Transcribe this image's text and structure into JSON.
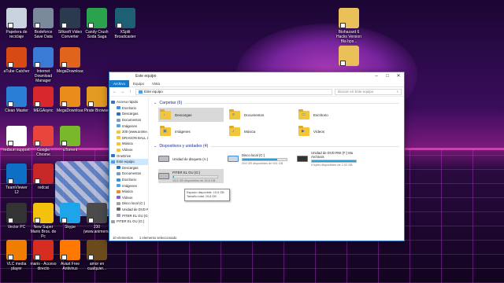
{
  "desktop": {
    "icons": [
      {
        "label": "Papelera de reciclaje",
        "icon": "recycle-bin-icon",
        "color": "#c9d3de"
      },
      {
        "label": "Bodeforce Save Data",
        "icon": "folder-icon",
        "color": "#7a8a9c"
      },
      {
        "label": "Silksoft Video Converter",
        "icon": "video-converter-icon",
        "color": "#2c3a50"
      },
      {
        "label": "Candy Crush Soda Saga",
        "icon": "candy-icon",
        "color": "#2ba24c"
      },
      {
        "label": "XSplit Broadcaster",
        "icon": "broadcast-icon",
        "color": "#1d5f75"
      },
      {
        "label": "aTube Catcher",
        "icon": "atube-icon",
        "color": "#d84a14"
      },
      {
        "label": "Internet Download Manager",
        "icon": "download-icon",
        "color": "#3a7bd5"
      },
      {
        "label": "MegaDownloader",
        "icon": "megadownloader-icon",
        "color": "#e0641c"
      },
      {
        "label": "Clean Master",
        "icon": "broom-icon",
        "color": "#2a7fd4"
      },
      {
        "label": "MEGAsync",
        "icon": "mega-icon",
        "color": "#d9272e"
      },
      {
        "label": "MegaDownloader",
        "icon": "megadownloader-icon",
        "color": "#e98c1c"
      },
      {
        "label": "Pirate Browser",
        "icon": "pirate-browser-icon",
        "color": "#e39b22"
      },
      {
        "label": "redsun support",
        "icon": "edge-icon",
        "color": "#ffffff"
      },
      {
        "label": "Google Chrome",
        "icon": "chrome-icon",
        "color": "#e8453c"
      },
      {
        "label": "uTorrent",
        "icon": "utorrent-icon",
        "color": "#78b82a"
      },
      {
        "label": "TeamViewer 12",
        "icon": "teamviewer-icon",
        "color": "#0e6fc6"
      },
      {
        "label": "redcat",
        "icon": "app-icon",
        "color": "#c62828"
      },
      {
        "label": "Vector PC",
        "icon": "app-icon",
        "color": "#333333"
      },
      {
        "label": "New Super Mario Bros. de Pc",
        "icon": "star-icon",
        "color": "#f4c20d"
      },
      {
        "label": "Skype",
        "icon": "skype-icon",
        "color": "#1ea4e9"
      },
      {
        "label": "230 (www.animemang...)",
        "icon": "folder-icon",
        "color": "#4b4b4b"
      },
      {
        "label": "VLC media player",
        "icon": "vlc-icon",
        "color": "#f07d00"
      },
      {
        "label": "mario - Acceso directo",
        "icon": "mario-icon",
        "color": "#d62d20"
      },
      {
        "label": "Avast Free Antivirus",
        "icon": "avast-icon",
        "color": "#ff7800"
      },
      {
        "label": "amor en cualquier...",
        "icon": "folder-icon",
        "color": "#6b4a1b"
      },
      {
        "label": "Biohazard 6 Hacks Version Bla bps...",
        "icon": "document-icon",
        "color": "#eac05a"
      },
      {
        "label": "",
        "icon": "document-icon",
        "color": "#eac05a"
      }
    ]
  },
  "explorer": {
    "title": "Este equipo",
    "tabs": [
      "Archivo",
      "Equipo",
      "Vista"
    ],
    "nav_back": "←",
    "nav_forward": "→",
    "nav_up": "↑",
    "address": "Este equipo",
    "search_placeholder": "Buscar en Este equipo",
    "nav_pane": [
      {
        "label": "Acceso rápido",
        "level": 0,
        "color": "#2f78c9"
      },
      {
        "label": "Escritorio",
        "level": 1,
        "color": "#3d8fd9"
      },
      {
        "label": "Descargas",
        "level": 1,
        "color": "#2a6fc0"
      },
      {
        "label": "Documentos",
        "level": 1,
        "color": "#7f9cb7"
      },
      {
        "label": "Imágenes",
        "level": 1,
        "color": "#5aa0d8"
      },
      {
        "label": "200 (www.anime...",
        "level": 1,
        "color": "#f3c53c"
      },
      {
        "label": "DRAGON BALL SU...",
        "level": 1,
        "color": "#f3c53c"
      },
      {
        "label": "Música",
        "level": 1,
        "color": "#f3c53c"
      },
      {
        "label": "Vídeos",
        "level": 1,
        "color": "#f3c53c"
      },
      {
        "label": "OneDrive",
        "level": 0,
        "color": "#1e7ad6"
      },
      {
        "label": "Este equipo",
        "level": 0,
        "color": "#4a9ee6",
        "selected": true
      },
      {
        "label": "Descargas",
        "level": 1,
        "color": "#2a6fc0"
      },
      {
        "label": "Documentos",
        "level": 1,
        "color": "#7f9cb7"
      },
      {
        "label": "Escritorio",
        "level": 1,
        "color": "#3d8fd9"
      },
      {
        "label": "Imágenes",
        "level": 1,
        "color": "#5aa0d8"
      },
      {
        "label": "Música",
        "level": 1,
        "color": "#e58c2b"
      },
      {
        "label": "Vídeos",
        "level": 1,
        "color": "#7a66c7"
      },
      {
        "label": "Disco local (C:)",
        "level": 1,
        "color": "#9aa3ad"
      },
      {
        "label": "Unidad de DVD R...",
        "level": 1,
        "color": "#6a6a6a"
      },
      {
        "label": "PITER EL GU (G:)",
        "level": 1,
        "color": "#9aa3ad"
      },
      {
        "label": "PITER EL GU (G:)",
        "level": 0,
        "color": "#9aa3ad"
      }
    ],
    "folders_header": "Carpetas (6)",
    "folders": [
      {
        "label": "Descargas",
        "glyph": "↓",
        "selected": true
      },
      {
        "label": "Documentos",
        "glyph": "≡"
      },
      {
        "label": "Escritorio",
        "glyph": "▭"
      },
      {
        "label": "Imágenes",
        "glyph": "▣"
      },
      {
        "label": "Música",
        "glyph": "♪"
      },
      {
        "label": "Vídeos",
        "glyph": "▶"
      }
    ],
    "devices_header": "Dispositivos y unidades (4)",
    "devices": [
      {
        "name": "Unidad de disquete (A:)",
        "detail": "",
        "used_fraction": null,
        "kind": "floppy"
      },
      {
        "name": "Disco local (C:)",
        "detail": "204 GB disponibles de 931 GB",
        "used_fraction": 0.78,
        "kind": "windows-drive"
      },
      {
        "name": "Unidad de DVD RW (F:) Mu Archivos",
        "detail": "0 bytes disponibles de 2,02 GB",
        "used_fraction": 1.0,
        "kind": "dvd"
      },
      {
        "name": "PITER EL GU (G:)",
        "detail": "15,5 GB disponibles de 15,6 GB",
        "used_fraction": 0.01,
        "kind": "usb",
        "selected": true
      }
    ],
    "tooltip": {
      "line1": "Espacio disponible: 15,5 GB",
      "line2": "Tamaño total: 15,6 GB"
    },
    "status": {
      "items": "10 elementos",
      "selected": "1 elemento seleccionado"
    }
  }
}
